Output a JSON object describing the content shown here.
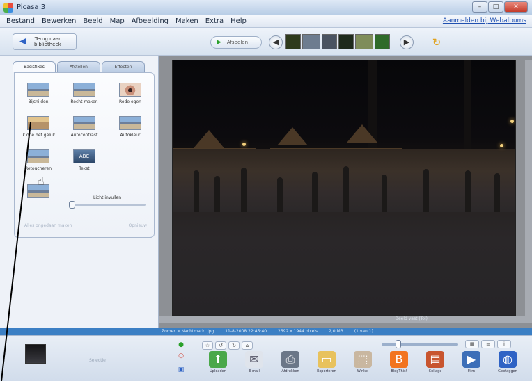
{
  "window": {
    "title": "Picasa 3",
    "controls": [
      "–",
      "□",
      "✕"
    ]
  },
  "menu": {
    "items": [
      "Bestand",
      "Bewerken",
      "Beeld",
      "Map",
      "Afbeelding",
      "Maken",
      "Extra",
      "Help"
    ],
    "right_link": "Aanmelden bij Webalbums"
  },
  "toolbar": {
    "back_label_line1": "Terug naar",
    "back_label_line2": "bibliotheek",
    "play_label": "Afspelen",
    "filmstrip_colors": [
      "#2e3a1c",
      "#6d7c8f",
      "#4a5361",
      "#1e2a1c",
      "#7f8d5a",
      "#2f6b2a"
    ]
  },
  "edit_panel": {
    "tabs": [
      "Basisfixes",
      "Afstellen",
      "Effecten"
    ],
    "tools": [
      {
        "label": "Bijsnijden",
        "icon": "crop-icon"
      },
      {
        "label": "Recht maken",
        "icon": "straighten-icon"
      },
      {
        "label": "Rode ogen",
        "icon": "red-eye-icon"
      },
      {
        "label": "Ik doe het geluk",
        "icon": "feeling-lucky-icon"
      },
      {
        "label": "Autocontrast",
        "icon": "auto-contrast-icon"
      },
      {
        "label": "Autokleur",
        "icon": "auto-color-icon"
      },
      {
        "label": "Retoucheren",
        "icon": "retouch-icon"
      },
      {
        "label": "Tekst",
        "icon": "text-icon"
      }
    ],
    "slider_label": "Licht invullen",
    "slider_value": 0,
    "bottom_left": "Alles ongedaan maken",
    "bottom_right": "Opnieuw"
  },
  "viewer": {
    "zoom_label": "Beeld vast (Tol)"
  },
  "status": {
    "items": [
      "Zomer > Nachtmarkt.jpg",
      "11-8-2008 22:45:40",
      "2592 x 1944 pixels",
      "2,0 MB",
      "(1 van 1)"
    ]
  },
  "tray": {
    "selection_label": "Selectie",
    "actions": [
      "Uploaden",
      "E-mail",
      "Afdrukken",
      "Exporteren",
      "Winkel",
      "BlogThis!",
      "Collage",
      "Film",
      "Geotaggen"
    ]
  }
}
